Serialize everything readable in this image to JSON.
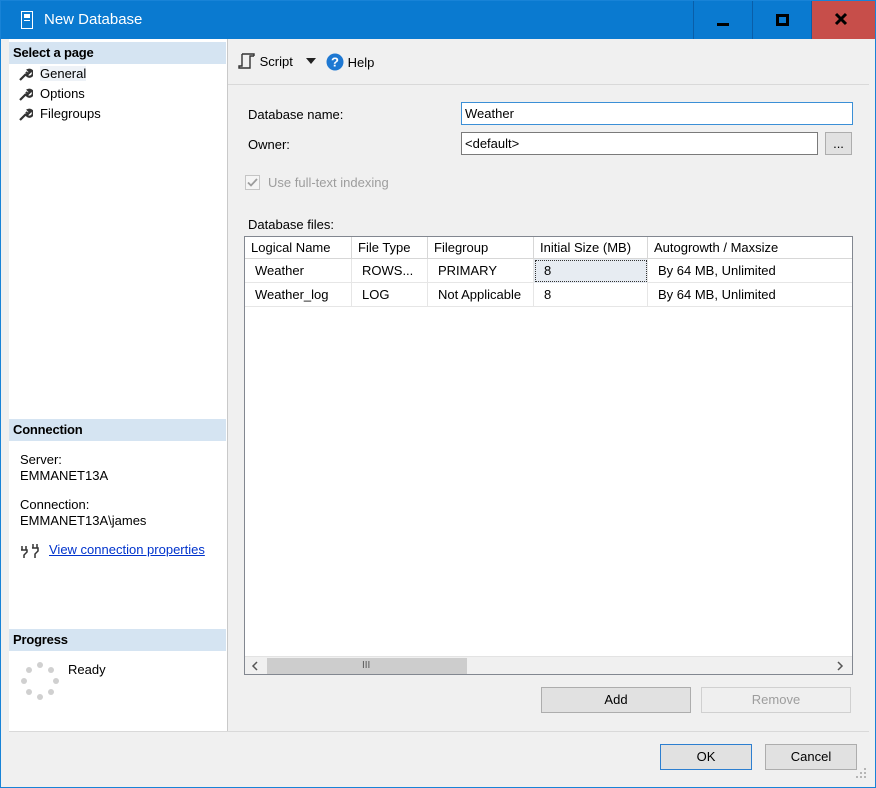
{
  "window": {
    "title": "New Database"
  },
  "left": {
    "select_page_header": "Select a page",
    "pages": [
      {
        "label": "General",
        "selected": true
      },
      {
        "label": "Options",
        "selected": false
      },
      {
        "label": "Filegroups",
        "selected": false
      }
    ],
    "connection_header": "Connection",
    "server_label": "Server:",
    "server_value": "EMMANET13A",
    "connection_label": "Connection:",
    "connection_value": "EMMANET13A\\james",
    "view_props_link": "View connection properties",
    "progress_header": "Progress",
    "progress_status": "Ready"
  },
  "toolbar": {
    "script_label": "Script",
    "help_label": "Help"
  },
  "form": {
    "db_name_label": "Database name:",
    "db_name_value": "Weather",
    "owner_label": "Owner:",
    "owner_value": "<default>",
    "browse_label": "...",
    "fulltext_label": "Use full-text indexing",
    "fulltext_checked": true,
    "files_label": "Database files:"
  },
  "grid": {
    "columns": [
      "Logical Name",
      "File Type",
      "Filegroup",
      "Initial Size (MB)",
      "Autogrowth / Maxsize"
    ],
    "rows": [
      [
        "Weather",
        "ROWS...",
        "PRIMARY",
        "8",
        "By 64 MB, Unlimited"
      ],
      [
        "Weather_log",
        "LOG",
        "Not Applicable",
        "8",
        "By 64 MB, Unlimited"
      ]
    ],
    "scroll_thumb_glyph": "III"
  },
  "buttons": {
    "add": "Add",
    "remove": "Remove",
    "ok": "OK",
    "cancel": "Cancel"
  },
  "colors": {
    "titlebar": "#0a7ad0",
    "close": "#c74e4a",
    "section_header": "#d5e4f2",
    "link": "#0033cc"
  }
}
